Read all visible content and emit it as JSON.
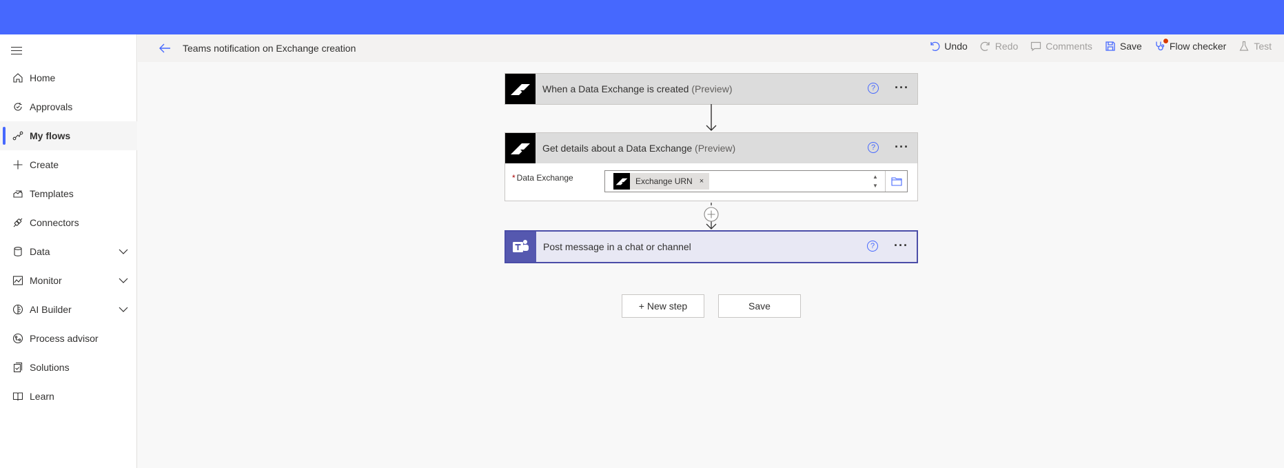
{
  "header": {
    "flow_title": "Teams notification on Exchange creation"
  },
  "commands": {
    "undo": "Undo",
    "redo": "Redo",
    "comments": "Comments",
    "save": "Save",
    "flow_checker": "Flow checker",
    "test": "Test"
  },
  "sidebar": {
    "items": [
      {
        "label": "Home",
        "icon": "home-icon"
      },
      {
        "label": "Approvals",
        "icon": "approvals-icon"
      },
      {
        "label": "My flows",
        "icon": "flows-icon",
        "active": true
      },
      {
        "label": "Create",
        "icon": "plus-icon"
      },
      {
        "label": "Templates",
        "icon": "templates-icon"
      },
      {
        "label": "Connectors",
        "icon": "connectors-icon"
      },
      {
        "label": "Data",
        "icon": "data-icon",
        "expandable": true
      },
      {
        "label": "Monitor",
        "icon": "monitor-icon",
        "expandable": true
      },
      {
        "label": "AI Builder",
        "icon": "ai-builder-icon",
        "expandable": true
      },
      {
        "label": "Process advisor",
        "icon": "process-advisor-icon"
      },
      {
        "label": "Solutions",
        "icon": "solutions-icon"
      },
      {
        "label": "Learn",
        "icon": "learn-icon"
      }
    ]
  },
  "steps": [
    {
      "title": "When a Data Exchange is created",
      "tag": "(Preview)",
      "connector": "autodesk-logo"
    },
    {
      "title": "Get details about a Data Exchange",
      "tag": "(Preview)",
      "connector": "autodesk-logo",
      "field": {
        "label": "Data Exchange",
        "required_mark": "*",
        "token": "Exchange URN",
        "token_remove": "×"
      }
    },
    {
      "title": "Post message in a chat or channel",
      "connector": "teams-logo"
    }
  ],
  "actions": {
    "new_step": "+ New step",
    "save": "Save"
  },
  "colors": {
    "brand": "#4668fe",
    "teams": "#5558af",
    "alert_dot": "#d83b01"
  }
}
